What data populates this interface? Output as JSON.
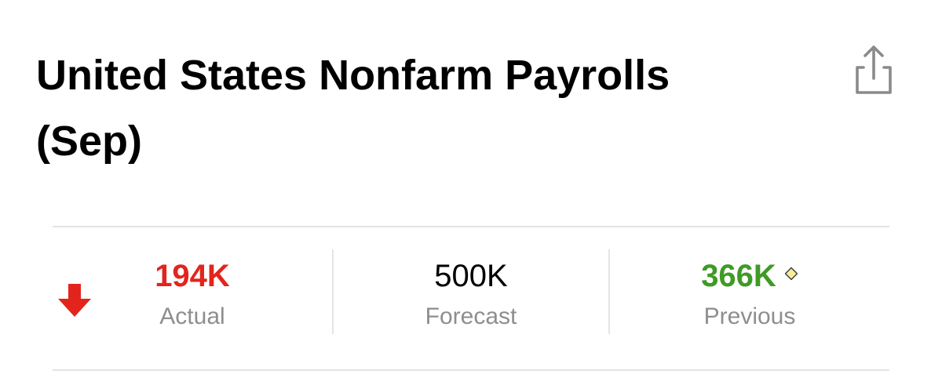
{
  "header": {
    "title": "United States Nonfarm Payrolls (Sep)",
    "share_icon": "share-icon"
  },
  "stats": {
    "trend_icon": "arrow-down-icon",
    "actual": {
      "value": "194K",
      "label": "Actual",
      "color": "#e3241d"
    },
    "forecast": {
      "value": "500K",
      "label": "Forecast",
      "color": "#000000"
    },
    "previous": {
      "value": "366K",
      "label": "Previous",
      "color": "#3f9a26",
      "revised_icon": "diamond-icon"
    }
  },
  "colors": {
    "negative": "#e3241d",
    "positive": "#3f9a26",
    "muted": "#8e8e8e",
    "divider": "#e3e3e3",
    "diamond": "#f7ec9a"
  }
}
